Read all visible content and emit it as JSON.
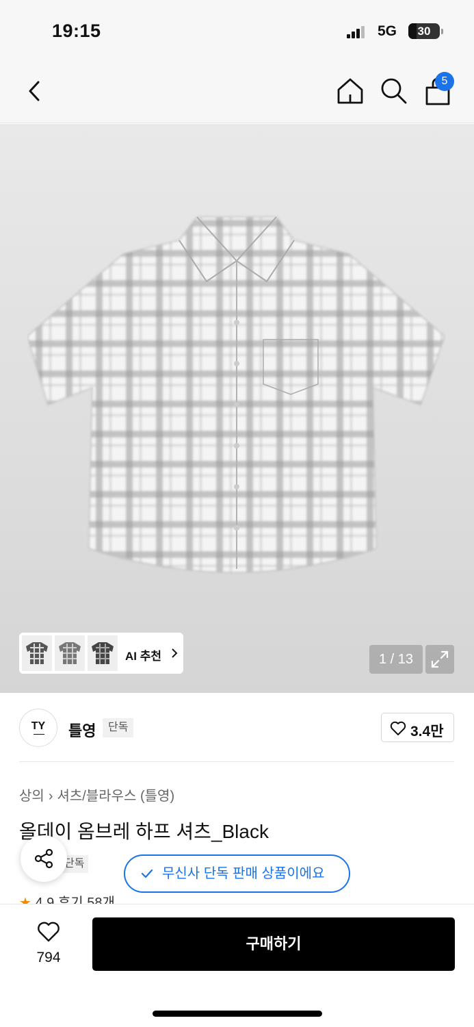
{
  "status_bar": {
    "time": "19:15",
    "network": "5G",
    "battery": "30"
  },
  "nav": {
    "back_icon": "chevron-left-icon",
    "home_icon": "home-icon",
    "search_icon": "search-icon",
    "cart_icon": "shopping-bag-icon",
    "cart_count": "5",
    "badge_color": "#1a73e8"
  },
  "gallery": {
    "ai_recommend_label": "AI 추천",
    "page_counter": "1 / 13",
    "expand_icon": "expand-icon"
  },
  "brand": {
    "logo_text": "TY",
    "name": "틀영",
    "badge": "단독",
    "like_count": "3.4만",
    "like_icon": "heart-outline-icon"
  },
  "breadcrumb": {
    "category": "상의",
    "subcategory": "셔츠/블라우스 (틀영)"
  },
  "product": {
    "title": "올데이 옴브레 하프 셔츠_Black",
    "exclusive_tag": "단독",
    "exclusive_message": "무신사 단독 판매 상품이에요",
    "rating_text": "4.9 후기 58개"
  },
  "bottom_bar": {
    "like_count": "794",
    "buy_label": "구매하기",
    "like_icon": "heart-outline-icon",
    "share_icon": "share-icon"
  },
  "colors": {
    "accent": "#1a73e8",
    "buy_button": "#000000"
  }
}
